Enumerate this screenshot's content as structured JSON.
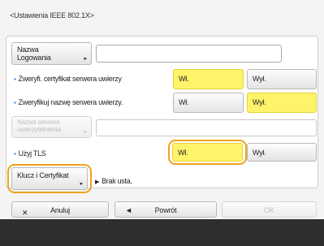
{
  "header": {
    "title": "<Ustawienia IEEE 802.1X>"
  },
  "form": {
    "login_name_button": "Nazwa Logowania",
    "login_name_value": "",
    "verify_cert": {
      "label": "Zweryfi. certyfikat serwera uwierzy",
      "on": "Wł.",
      "off": "Wył.",
      "selected": "on"
    },
    "verify_name": {
      "label": "Zweryfikuj nazwę serwera uwierzy.",
      "on": "Wł.",
      "off": "Wył.",
      "selected": "off"
    },
    "auth_server_name_button": "Nazwa serwera uwierzytelnienia",
    "auth_server_name_value": "",
    "use_tls": {
      "label": "Użyj TLS",
      "on": "Wł.",
      "off": "Wył.",
      "selected": "on"
    },
    "keys_cert_button": "Klucz i Certyfikat",
    "keys_cert_status": "Brak usta."
  },
  "footer": {
    "cancel": "Anuluj",
    "back": "Powrót",
    "ok": "OK"
  },
  "colors": {
    "selected": "#fff36a",
    "focus_ring": "#f0a21c",
    "bullet": "#2f7fd4"
  }
}
